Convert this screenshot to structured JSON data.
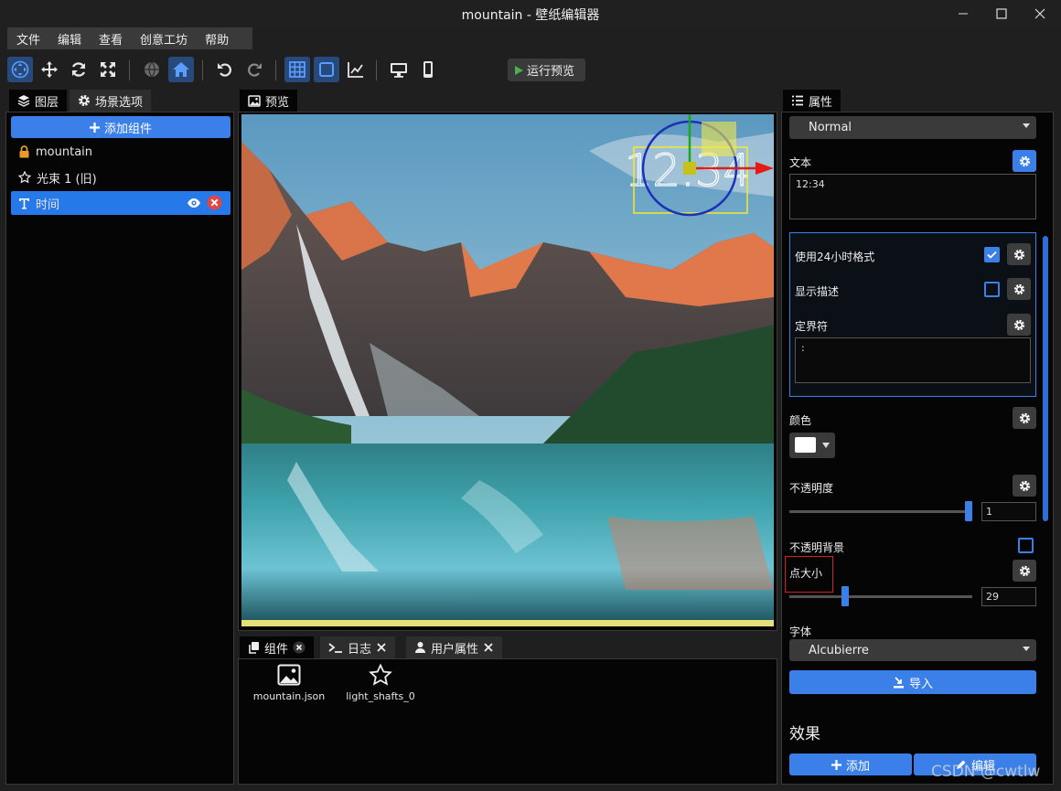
{
  "window": {
    "title": "mountain - 壁纸编辑器"
  },
  "menu": [
    "文件",
    "编辑",
    "查看",
    "创意工坊",
    "帮助"
  ],
  "toolbar": {
    "run_preview_label": "运行预览"
  },
  "layers_panel": {
    "tabs": [
      "图层",
      "场景选项"
    ],
    "add_component_label": "添加组件",
    "items": [
      {
        "label": "mountain",
        "icon": "lock-icon"
      },
      {
        "label": "光束 1 (旧)",
        "icon": "star-icon"
      },
      {
        "label": "时间",
        "icon": "text-icon",
        "selected": true
      }
    ]
  },
  "preview_panel": {
    "tab": "预览",
    "clock_text": "12:34"
  },
  "bottom_panel": {
    "tabs": [
      "组件",
      "日志",
      "用户属性"
    ],
    "assets": [
      {
        "label": "mountain.json",
        "icon": "image-icon"
      },
      {
        "label": "light_shafts_0",
        "icon": "star-icon"
      }
    ]
  },
  "properties": {
    "tab": "属性",
    "blend_mode": "Normal",
    "text_label": "文本",
    "text_value": "12:34",
    "use_24h_label": "使用24小时格式",
    "use_24h_checked": true,
    "show_desc_label": "显示描述",
    "show_desc_checked": false,
    "delimiter_label": "定界符",
    "delimiter_value": ":",
    "color_label": "颜色",
    "color_value": "#ffffff",
    "opacity_label": "不透明度",
    "opacity_value": "1",
    "opacity_fraction": 1.0,
    "opaque_bg_label": "不透明背景",
    "opaque_bg_checked": false,
    "point_size_label": "点大小",
    "point_size_value": "29",
    "font_label": "字体",
    "font_value": "Alcubierre",
    "import_label": "导入",
    "effects_title": "效果",
    "effects_add_label": "添加",
    "effects_edit_label": "编辑"
  },
  "watermark": "CSDN @cwtlw",
  "accent_color": "#3b80e8"
}
